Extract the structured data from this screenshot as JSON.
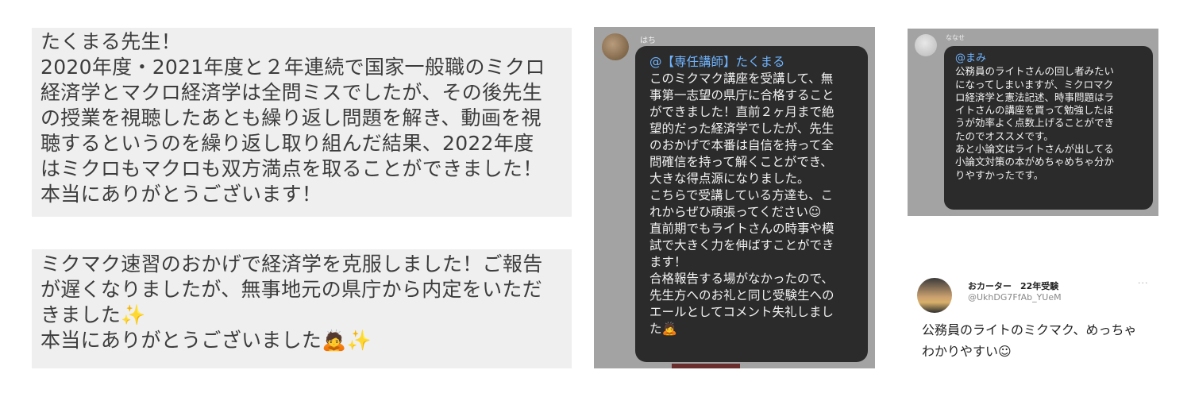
{
  "card1": {
    "lines": [
      "たくまる先生！",
      "2020年度・2021年度と２年連続で国家一般職のミクロ",
      "経済学とマクロ経済学は全問ミスでしたが、その後先生",
      "の授業を視聴したあとも繰り返し問題を解き、動画を視",
      "聴するというのを繰り返し取り組んだ結果、2022年度",
      "はミクロもマクロも双方満点を取ることができました！",
      "本当にありがとうございます！"
    ]
  },
  "card2": {
    "lines": [
      "ミクマク速習のおかげで経済学を克服しました！ご報告",
      "が遅くなりましたが、無事地元の県庁から内定をいただ",
      "きました✨",
      "本当にありがとうございました🙇✨"
    ]
  },
  "chat_a": {
    "username": "はち",
    "mention": "@【専任講師】たくまる",
    "lines": [
      "このミクマク講座を受講して、無",
      "事第一志望の県庁に合格すること",
      "ができました！直前２ヶ月まで絶",
      "望的だった経済学でしたが、先生",
      "のおかげで本番は自信を持って全",
      "問確信を持って解くことができ、",
      "大きな得点源になりました。",
      "こちらで受講している方達も、こ",
      "れからぜひ頑張ってください☺",
      "直前期でもライトさんの時事や模",
      "試で大きく力を伸ばすことができ",
      "ます！",
      "合格報告する場がなかったので、",
      "先生方へのお礼と同じ受験生への",
      "エールとしてコメント失礼しまし",
      "た🙇"
    ]
  },
  "chat_b": {
    "username": "ななせ",
    "mention": "@まみ",
    "lines": [
      "公務員のライトさんの回し者みたい",
      "になってしまいますが、ミクロマク",
      "ロ経済学と憲法記述、時事問題はラ",
      "イトさんの講座を買って勉強したほ",
      "うが効率よく点数上げることができ",
      "たのでオススメです。",
      "あと小論文はライトさんが出してる",
      "小論文対策の本がめちゃめちゃ分か",
      "りやすかったです。"
    ]
  },
  "tweet": {
    "name": "おカーター　22年受験",
    "handle": "@UkhDG7FfAb_YUeM",
    "menu": "···",
    "lines": [
      "公務員のライトのミクマク、めっちゃ",
      "わかりやすい☺"
    ]
  }
}
